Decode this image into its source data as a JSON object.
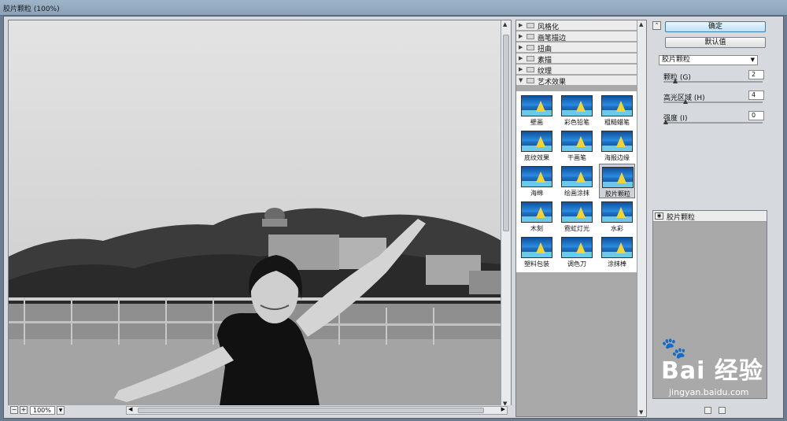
{
  "window": {
    "title": "胶片颗粒 (100%)"
  },
  "preview": {
    "zoom": "100%"
  },
  "gallery": {
    "categories": [
      "风格化",
      "画笔描边",
      "扭曲",
      "素描",
      "纹理",
      "艺术效果"
    ],
    "expanded_category": "艺术效果",
    "effects": [
      "壁画",
      "彩色铅笔",
      "粗糙蜡笔",
      "底纹效果",
      "干画笔",
      "海报边缘",
      "海绵",
      "绘画涂抹",
      "胶片颗粒",
      "木刻",
      "霓虹灯光",
      "水彩",
      "塑料包装",
      "调色刀",
      "涂抹棒"
    ],
    "selected_effect": "胶片颗粒"
  },
  "settings": {
    "ok_label": "确定",
    "default_label": "默认值",
    "filter_select": "胶片颗粒",
    "params": [
      {
        "label": "颗粒 (G)",
        "value": "2",
        "fraction": 0.1
      },
      {
        "label": "高光区域 (H)",
        "value": "4",
        "fraction": 0.2
      },
      {
        "label": "强度 (I)",
        "value": "0",
        "fraction": 0.0
      }
    ]
  },
  "layers": {
    "items": [
      "胶片颗粒"
    ]
  },
  "watermark": {
    "brand": "Bai 经验",
    "url": "jingyan.baidu.com"
  },
  "colors": {
    "primary_button": "#bde0f6",
    "window_bg": "#d6d9dd",
    "gallery_bg": "#a9a9a9"
  }
}
